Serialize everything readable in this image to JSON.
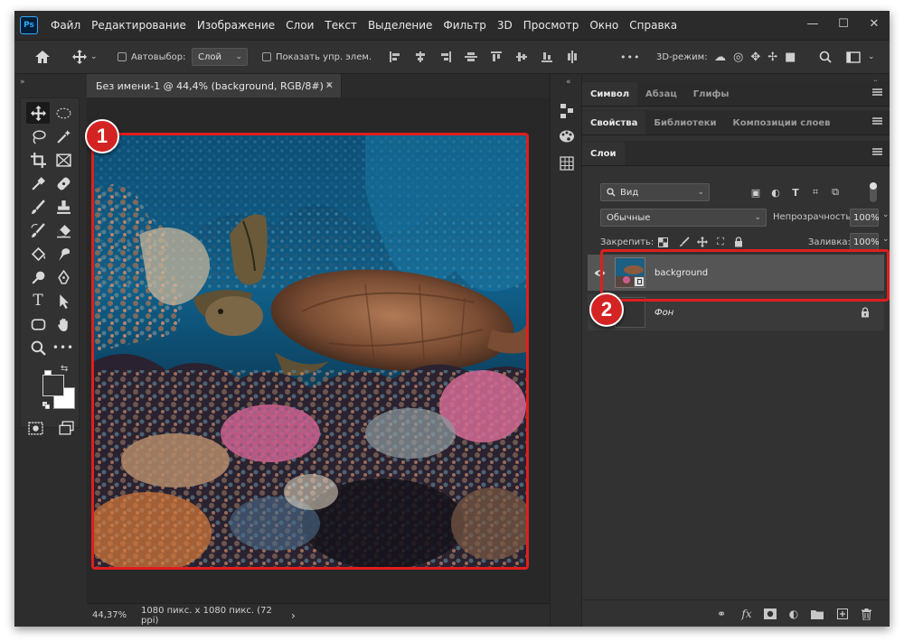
{
  "app": {
    "logo": "Ps"
  },
  "menu": [
    "Файл",
    "Редактирование",
    "Изображение",
    "Слои",
    "Текст",
    "Выделение",
    "Фильтр",
    "3D",
    "Просмотр",
    "Окно",
    "Справка"
  ],
  "window_controls": {
    "minimize": "—",
    "maximize": "☐",
    "close": "✕"
  },
  "options": {
    "auto_select_label": "Автовыбор:",
    "auto_select_value": "Слой",
    "show_controls_label": "Показать упр. элем.",
    "more": "•••",
    "mode_3d_label": "3D-режим:"
  },
  "document": {
    "tab_title": "Без имени-1 @ 44,4% (background, RGB/8#) *",
    "tab_close": "✕",
    "zoom": "44,37%",
    "doc_info": "1080 пикс. x 1080 пикс. (72 ppi)",
    "status_arrow": "›"
  },
  "annotations": {
    "badge1": "1",
    "badge2": "2",
    "accent": "#e01e1e"
  },
  "panels": {
    "group1": {
      "tabs": [
        "Символ",
        "Абзац",
        "Глифы"
      ],
      "active": 0
    },
    "group2": {
      "tabs": [
        "Свойства",
        "Библиотеки",
        "Композиции слоев"
      ],
      "active": 0
    },
    "group3": {
      "tabs": [
        "Слои"
      ],
      "active": 0
    }
  },
  "layers": {
    "filter_value": "Вид",
    "blend_mode": "Обычные",
    "opacity_label": "Непрозрачность:",
    "opacity_value": "100%",
    "lock_label": "Закрепить:",
    "fill_label": "Заливка:",
    "fill_value": "100%",
    "items": [
      {
        "name": "background",
        "selected": true,
        "visible": true,
        "smart_object": true
      },
      {
        "name": "Фон",
        "selected": false,
        "visible": false,
        "locked": true
      }
    ]
  },
  "icons": {
    "toolbar": [
      "move-tool",
      "ellipse-marquee-tool",
      "lasso-tool",
      "magic-wand-tool",
      "crop-tool",
      "frame-tool",
      "eyedropper-tool",
      "healing-brush-tool",
      "brush-tool",
      "clone-stamp-tool",
      "history-brush-tool",
      "eraser-tool",
      "paint-bucket-tool",
      "smudge-tool",
      "dodge-tool",
      "pen-tool",
      "type-tool",
      "path-selection-tool",
      "rectangle-tool",
      "hand-tool",
      "zoom-tool",
      "more-tools",
      "quick-mask",
      "screen-mode"
    ],
    "layers_footer": [
      "link-icon",
      "fx-icon",
      "mask-icon",
      "adjustment-icon",
      "folder-icon",
      "new-layer-icon",
      "trash-icon"
    ]
  },
  "colors": {
    "foreground": "#333333",
    "background": "#ffffff",
    "ui_bg": "#323232"
  }
}
